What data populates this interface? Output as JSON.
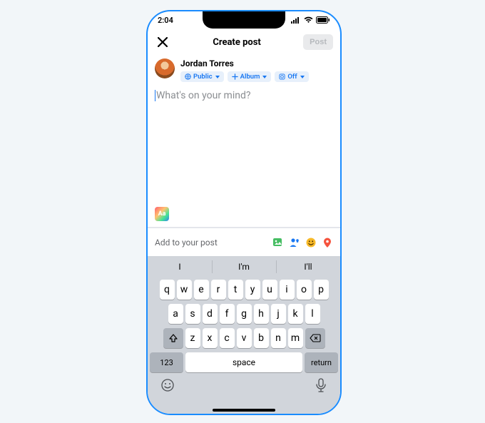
{
  "status": {
    "time": "2:04"
  },
  "nav": {
    "title": "Create post",
    "post": "Post"
  },
  "user": {
    "name": "Jordan Torres"
  },
  "chips": {
    "audience": "Public",
    "album": "Album",
    "off": "Off"
  },
  "compose": {
    "placeholder": "What's on your mind?"
  },
  "bg_picker": {
    "label": "Aa"
  },
  "addrow": {
    "label": "Add to your post"
  },
  "suggestions": [
    "I",
    "I'm",
    "I'll"
  ],
  "keys": {
    "r1": [
      "q",
      "w",
      "e",
      "r",
      "t",
      "y",
      "u",
      "i",
      "o",
      "p"
    ],
    "r2": [
      "a",
      "s",
      "d",
      "f",
      "g",
      "h",
      "j",
      "k",
      "l"
    ],
    "r3": [
      "z",
      "x",
      "c",
      "v",
      "b",
      "n",
      "m"
    ],
    "k123": "123",
    "space": "space",
    "ret": "return"
  }
}
